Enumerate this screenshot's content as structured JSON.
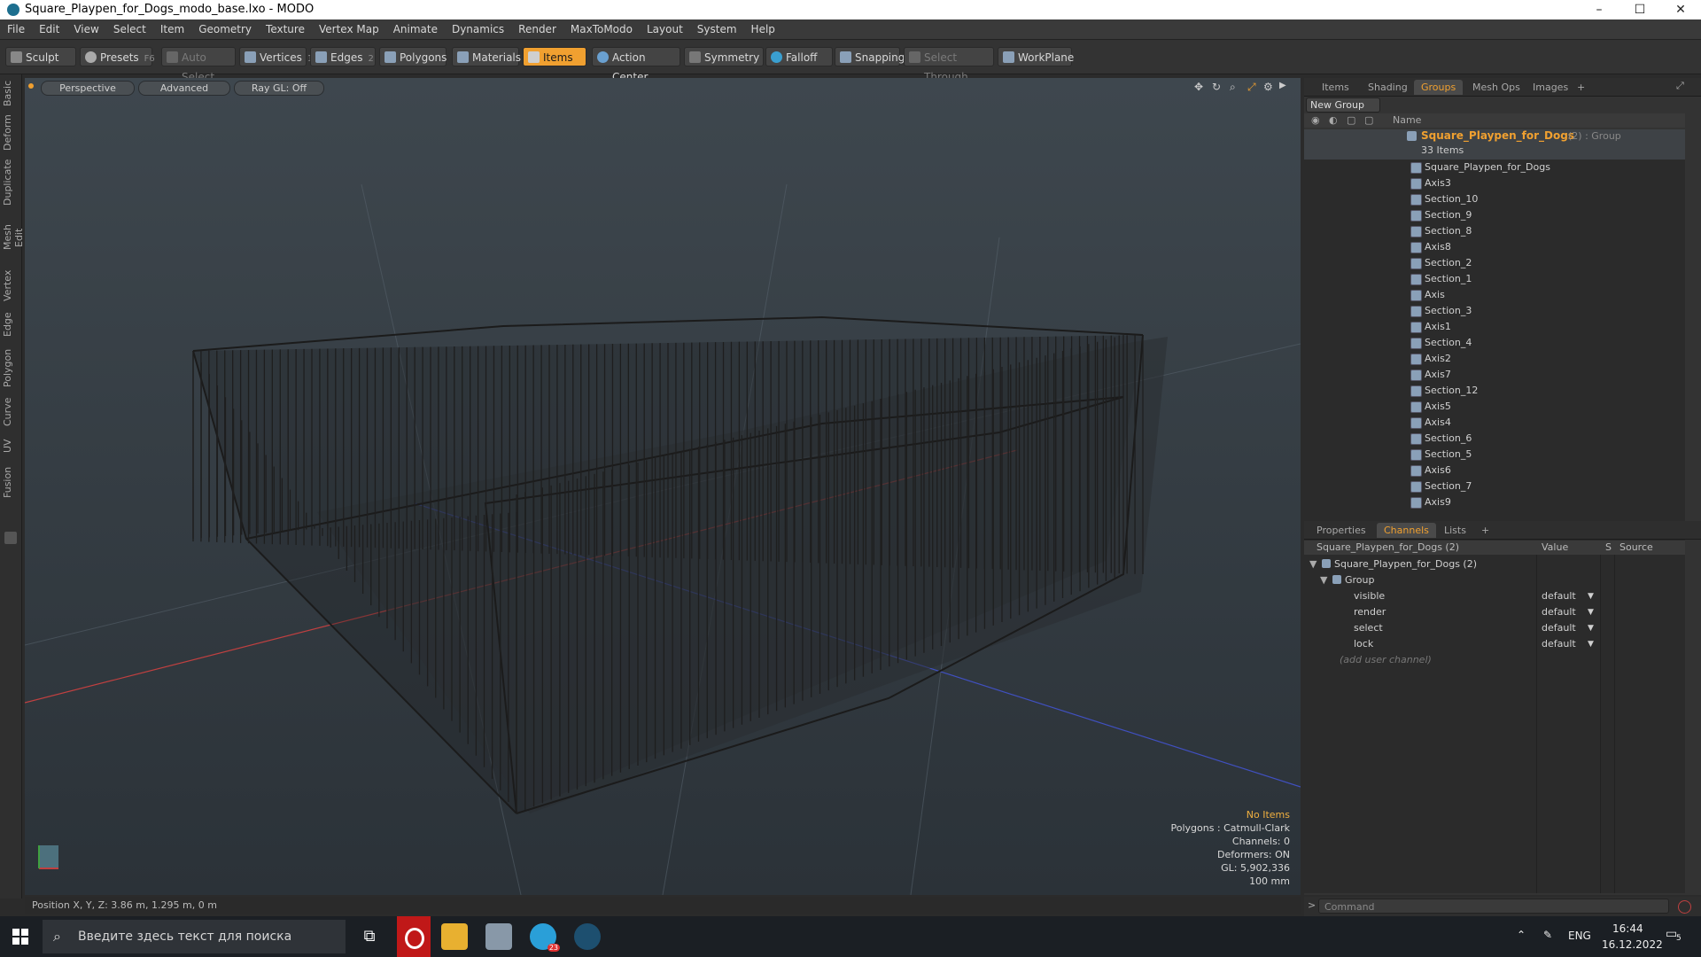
{
  "window": {
    "title": "Square_Playpen_for_Dogs_modo_base.lxo - MODO",
    "min": "–",
    "max": "☐",
    "close": "✕"
  },
  "menu": [
    "File",
    "Edit",
    "View",
    "Select",
    "Item",
    "Geometry",
    "Texture",
    "Vertex Map",
    "Animate",
    "Dynamics",
    "Render",
    "MaxToModo",
    "Layout",
    "System",
    "Help"
  ],
  "toolbar": {
    "sculpt": "Sculpt",
    "presets": "Presets",
    "presets_key": "F6",
    "auto_select": "Auto Select",
    "vertices": "Vertices",
    "vertices_key": "1",
    "edges": "Edges",
    "edges_key": "2",
    "polygons": "Polygons",
    "materials": "Materials",
    "items": "Items",
    "action_center": "Action Center",
    "symmetry": "Symmetry",
    "falloff": "Falloff",
    "snapping": "Snapping",
    "select_through": "Select Through",
    "workplane": "WorkPlane"
  },
  "left_tabs": [
    "Basic",
    "Deform",
    "Duplicate",
    "Mesh Edit",
    "Vertex",
    "Edge",
    "Polygon",
    "Curve",
    "UV",
    "Fusion"
  ],
  "viewport": {
    "mode": "Perspective",
    "shading": "Advanced",
    "raygl": "Ray GL: Off",
    "info": {
      "items": "No Items",
      "polygons": "Polygons : Catmull-Clark",
      "channels": "Channels: 0",
      "deformers": "Deformers: ON",
      "gl": "GL: 5,902,336",
      "grid": "100 mm"
    }
  },
  "status": {
    "position": "Position X, Y, Z:  3.86 m, 1.295 m, 0 m"
  },
  "groups_panel": {
    "tabs": [
      "Items",
      "Shading",
      "Groups",
      "Mesh Ops",
      "Images",
      "+"
    ],
    "new_group": "New Group",
    "name_header": "Name",
    "group_name": "Square_Playpen_for_Dogs",
    "group_suffix": "(2) : Group",
    "count": "33 Items",
    "items": [
      "Square_Playpen_for_Dogs",
      "Axis3",
      "Section_10",
      "Section_9",
      "Section_8",
      "Axis8",
      "Section_2",
      "Section_1",
      "Axis",
      "Section_3",
      "Axis1",
      "Section_4",
      "Axis2",
      "Axis7",
      "Section_12",
      "Axis5",
      "Axis4",
      "Section_6",
      "Section_5",
      "Axis6",
      "Section_7",
      "Axis9"
    ]
  },
  "channels_panel": {
    "tabs": [
      "Properties",
      "Channels",
      "Lists",
      "+"
    ],
    "header_name": "Square_Playpen_for_Dogs (2)",
    "header_value": "Value",
    "header_s": "S",
    "header_source": "Source",
    "root": "Square_Playpen_for_Dogs (2)",
    "group": "Group",
    "channels": [
      {
        "name": "visible",
        "value": "default"
      },
      {
        "name": "render",
        "value": "default"
      },
      {
        "name": "select",
        "value": "default"
      },
      {
        "name": "lock",
        "value": "default"
      }
    ],
    "add_user": "(add user channel)"
  },
  "command": {
    "placeholder": "Command",
    "prompt": ">"
  },
  "taskbar": {
    "search": "Введите здесь текст для поиска",
    "lang": "ENG",
    "time": "16:44",
    "date": "16.12.2022",
    "notif": "5",
    "telegram_badge": "23"
  },
  "colors": {
    "accent": "#f0a030",
    "x_axis": "#c04040",
    "z_axis": "#4050c0"
  }
}
